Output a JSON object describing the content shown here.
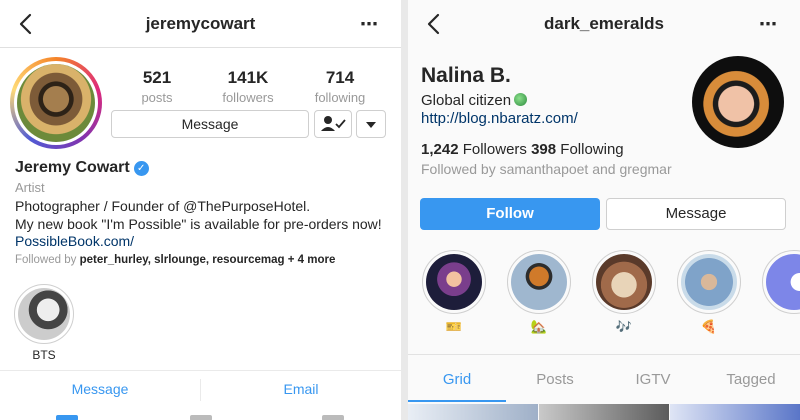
{
  "left": {
    "header": {
      "title": "jeremycowart",
      "more_icon": "⋯"
    },
    "stats": [
      {
        "value": "521",
        "label": "posts"
      },
      {
        "value": "141K",
        "label": "followers"
      },
      {
        "value": "714",
        "label": "following"
      }
    ],
    "message_button": "Message",
    "profile": {
      "name": "Jeremy Cowart",
      "category": "Artist",
      "bio_line1": "Photographer / Founder of @ThePurposeHotel.",
      "bio_line2": "My new book \"I'm Possible\" is available for pre-orders now!",
      "link": "PossibleBook.com/",
      "followed_by_prefix": "Followed by",
      "followed_by_users": "peter_hurley, slrlounge, resourcemag",
      "followed_by_more": "+ 4 more"
    },
    "highlight": {
      "label": "BTS"
    },
    "contact": {
      "message": "Message",
      "email": "Email"
    },
    "colors": {
      "link": "#003569",
      "accent": "#3897f0"
    }
  },
  "right": {
    "header": {
      "title": "dark_emeralds",
      "more_icon": "⋯"
    },
    "profile": {
      "name": "Nalina B.",
      "bio": "Global citizen",
      "link": "http://blog.nbaratz.com/",
      "followers_count": "1,242",
      "followers_label": "Followers",
      "following_count": "398",
      "following_label": "Following",
      "followed_by_prefix": "Followed by",
      "followed_by_user1": "samanthapoet",
      "followed_by_and": "and",
      "followed_by_user2": "gregmar"
    },
    "follow_button": "Follow",
    "message_button": "Message",
    "stories": [
      {
        "label": "🎫"
      },
      {
        "label": "🏡"
      },
      {
        "label": "🎶"
      },
      {
        "label": "🍕"
      },
      {
        "label": ""
      }
    ],
    "tabs": [
      {
        "label": "Grid",
        "active": true
      },
      {
        "label": "Posts"
      },
      {
        "label": "IGTV"
      },
      {
        "label": "Tagged"
      }
    ],
    "colors": {
      "follow_button": "#3897f0",
      "tab_active": "#3897f0"
    }
  }
}
